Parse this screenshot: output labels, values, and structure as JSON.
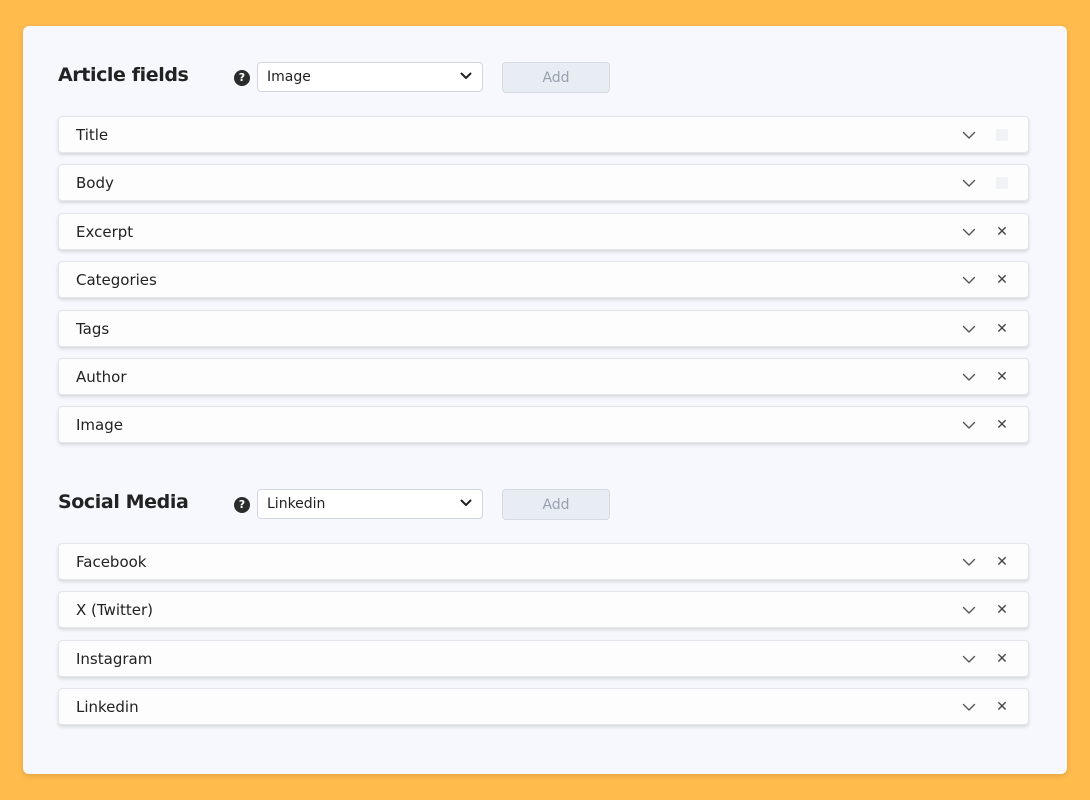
{
  "article_section": {
    "title": "Article fields",
    "help_icon": "?",
    "select_value": "Image",
    "add_label": "Add",
    "rows": [
      {
        "label": "Title",
        "removable": false
      },
      {
        "label": "Body",
        "removable": false
      },
      {
        "label": "Excerpt",
        "removable": true
      },
      {
        "label": "Categories",
        "removable": true
      },
      {
        "label": "Tags",
        "removable": true
      },
      {
        "label": "Author",
        "removable": true
      },
      {
        "label": "Image",
        "removable": true
      }
    ]
  },
  "social_section": {
    "title": "Social Media",
    "help_icon": "?",
    "select_value": "Linkedin",
    "add_label": "Add",
    "rows": [
      {
        "label": "Facebook",
        "removable": true
      },
      {
        "label": "X (Twitter)",
        "removable": true
      },
      {
        "label": "Instagram",
        "removable": true
      },
      {
        "label": "Linkedin",
        "removable": true
      }
    ]
  },
  "icons": {
    "help": "question-circle-icon",
    "select_chevron": "chevron-down-icon",
    "row_chevron": "chevron-down-icon",
    "row_remove": "close-icon"
  },
  "colors": {
    "background": "#ffbb4c",
    "panel": "#f6f8fd",
    "add_button_bg": "#e8ecf3",
    "add_button_text": "#9aa1ae"
  }
}
